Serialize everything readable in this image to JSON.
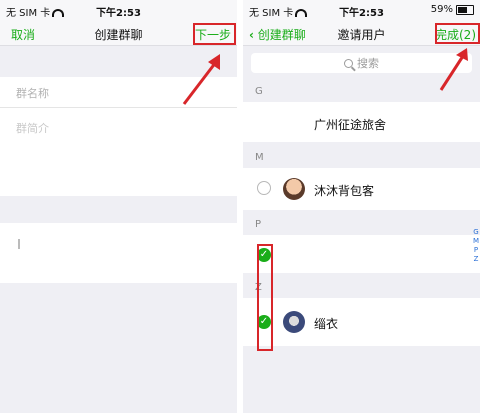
{
  "left": {
    "status": {
      "carrier": "无 SIM 卡",
      "time": "下午2:53"
    },
    "nav": {
      "cancel": "取消",
      "title": "创建群聊",
      "next": "下一步"
    },
    "group_name_placeholder": "群名称",
    "group_intro_label": "群简介"
  },
  "right": {
    "status": {
      "carrier": "无 SIM 卡",
      "time": "下午2:53",
      "battery": "59%"
    },
    "nav": {
      "back": "创建群聊",
      "title": "邀请用户",
      "done": "完成(2)"
    },
    "search_placeholder": "搜索",
    "sections": [
      {
        "letter": "G",
        "contacts": [
          {
            "name": "广州征途旅舍",
            "selected": false
          }
        ]
      },
      {
        "letter": "M",
        "contacts": [
          {
            "name": "沐沐背包客",
            "selected": false
          }
        ]
      },
      {
        "letter": "P",
        "contacts": [
          {
            "name": "",
            "selected": true
          }
        ]
      },
      {
        "letter": "Z",
        "contacts": [
          {
            "name": "缁衣",
            "selected": true
          }
        ]
      }
    ],
    "index_letters": [
      "G",
      "M",
      "P",
      "Z"
    ]
  },
  "colors": {
    "accent_green": "#1aad19",
    "annotation_red": "#d8262a",
    "bg": "#efeff4"
  },
  "icons": [
    "wifi-icon",
    "battery-icon",
    "back-chevron-icon",
    "search-icon",
    "check-icon",
    "arrow-annotation-icon"
  ]
}
